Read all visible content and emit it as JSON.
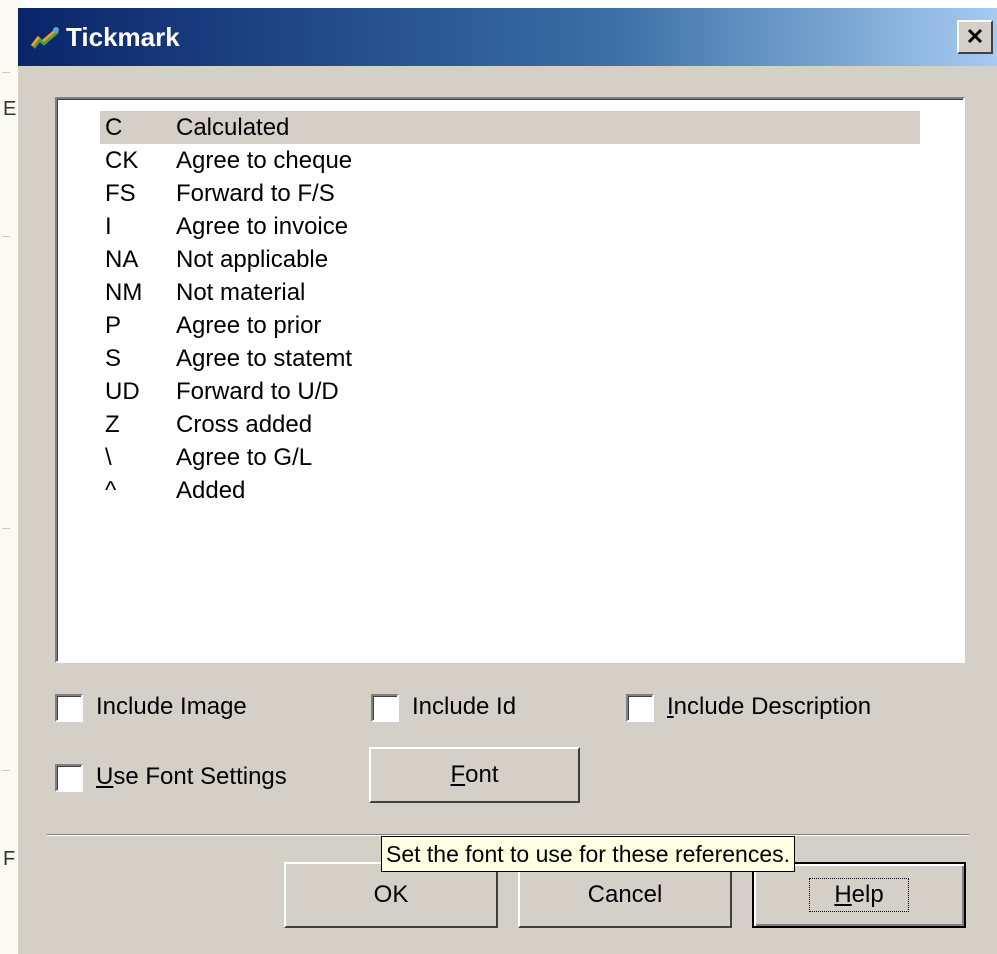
{
  "window": {
    "title": "Tickmark",
    "close_glyph": "✕"
  },
  "list": {
    "items": [
      {
        "id": "C",
        "description": "Calculated",
        "selected": true
      },
      {
        "id": "CK",
        "description": "Agree to cheque"
      },
      {
        "id": "FS",
        "description": "Forward to F/S"
      },
      {
        "id": "I",
        "description": "Agree to invoice"
      },
      {
        "id": "NA",
        "description": "Not applicable"
      },
      {
        "id": "NM",
        "description": "Not material"
      },
      {
        "id": "P",
        "description": "Agree to prior"
      },
      {
        "id": "S",
        "description": "Agree to statemt"
      },
      {
        "id": "UD",
        "description": "Forward to U/D"
      },
      {
        "id": "Z",
        "description": "Cross added"
      },
      {
        "id": "\\",
        "description": "Agree to G/L"
      },
      {
        "id": "^",
        "description": "Added"
      }
    ]
  },
  "options": {
    "include_image": {
      "label": "Include Image",
      "checked": false
    },
    "include_id": {
      "label": "Include Id",
      "checked": false
    },
    "include_description": {
      "label_prefix": "I",
      "label_rest": "nclude Description",
      "checked": false
    },
    "use_font_settings": {
      "label_prefix": "U",
      "label_rest": "se Font Settings",
      "checked": false
    }
  },
  "buttons": {
    "font": {
      "prefix": "F",
      "rest": "ont"
    },
    "ok": "OK",
    "cancel": "Cancel",
    "help": {
      "prefix": "H",
      "rest": "elp"
    }
  },
  "tooltip": "Set the font to use for these references.",
  "background_app": {
    "chars": [
      "E",
      "F"
    ]
  },
  "colors": {
    "title_start": "#0a246a",
    "title_end": "#a6caf0",
    "dialog_face": "#d4d0c8",
    "tooltip_bg": "#ffffe1"
  },
  "icons": {
    "title": "tickmark-app-icon",
    "close": "close-icon"
  }
}
